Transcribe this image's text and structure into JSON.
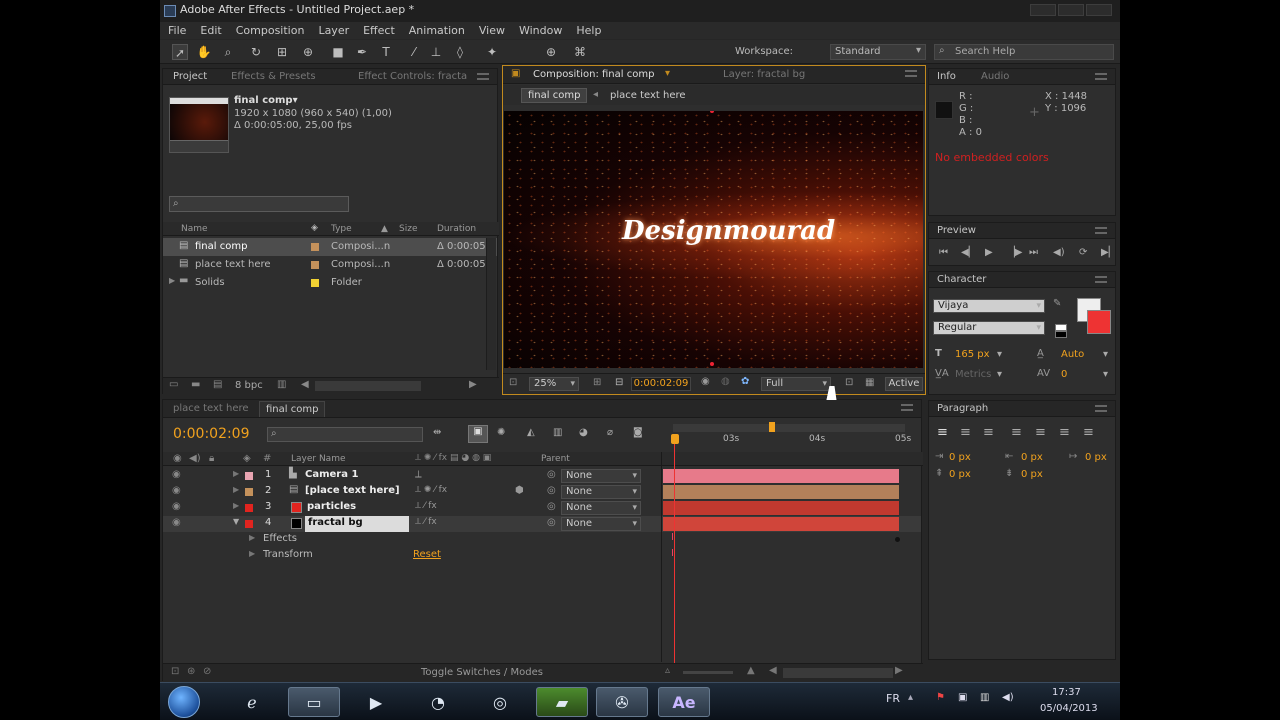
{
  "app": {
    "title": "Adobe After Effects - Untitled Project.aep *",
    "menu": [
      "File",
      "Edit",
      "Composition",
      "Layer",
      "Effect",
      "Animation",
      "View",
      "Window",
      "Help"
    ]
  },
  "toolbar": {
    "workspace_label": "Workspace:",
    "workspace_value": "Standard",
    "search_help_placeholder": "Search Help"
  },
  "project": {
    "tabs": [
      "Project",
      "Effects & Presets",
      "Effect Controls: fracta"
    ],
    "selected_name": "final comp▾",
    "selected_info_1": "1920 x 1080  (960 x 540) (1,00)",
    "selected_info_2": "Δ 0:00:05:00, 25,00 fps",
    "columns": [
      "Name",
      "Type",
      "Size",
      "Duration"
    ],
    "items": [
      {
        "name": "final comp",
        "type": "Composi...n",
        "duration": "Δ 0:00:05",
        "label_color": "#c4915b",
        "selected": true
      },
      {
        "name": "place text here",
        "type": "Composi...n",
        "duration": "Δ 0:00:05",
        "label_color": "#c4915b",
        "selected": false
      },
      {
        "name": "Solids",
        "type": "Folder",
        "duration": "",
        "label_color": "#f2d233",
        "selected": false
      }
    ],
    "bpc": "8 bpc"
  },
  "composition": {
    "tabs": [
      "Composition: final comp",
      "Layer: fractal bg"
    ],
    "breadcrumbs": [
      "final comp",
      "place text here"
    ],
    "preview_text": "Designmourad",
    "zoom": "25%",
    "timecode": "0:00:02:09",
    "resolution": "Full",
    "camera": "Active"
  },
  "info": {
    "tabs": [
      "Info",
      "Audio"
    ],
    "r": "R :",
    "g": "G :",
    "b": "B :",
    "a": "A : 0",
    "x": "X : 1448",
    "y": "Y : 1096",
    "message": "No embedded colors"
  },
  "preview": {
    "title": "Preview"
  },
  "character": {
    "title": "Character",
    "font": "Vijaya",
    "style": "Regular",
    "size": "165 px",
    "leading": "Auto",
    "kerning": "Metrics",
    "tracking": "0"
  },
  "paragraph": {
    "title": "Paragraph",
    "indent_left": "0 px",
    "indent_right": "0 px",
    "indent_first": "0 px",
    "space_before": "0 px",
    "space_after": "0 px"
  },
  "timeline": {
    "tabs": [
      "place text here",
      "final comp"
    ],
    "timecode": "0:00:02:09",
    "columns": {
      "layer_name": "Layer Name",
      "parent": "Parent"
    },
    "ruler": [
      "03s",
      "04s",
      "05s"
    ],
    "layers": [
      {
        "num": "1",
        "name": "Camera 1",
        "label_color": "#e9a5b2",
        "parent": "None",
        "bar": "#e77a8a",
        "icon": "camera"
      },
      {
        "num": "2",
        "name": "[place text here]",
        "label_color": "#c4915b",
        "parent": "None",
        "bar": "#b3805a",
        "icon": "comp"
      },
      {
        "num": "3",
        "name": "particles",
        "label_color": "#e1241f",
        "parent": "None",
        "bar": "#c1392f",
        "icon": "solid-red"
      },
      {
        "num": "4",
        "name": "fractal bg",
        "label_color": "#e1241f",
        "parent": "None",
        "bar": "#d0453a",
        "icon": "solid-black",
        "selected": true
      }
    ],
    "sub_rows": [
      "Effects",
      "Transform"
    ],
    "reset_label": "Reset",
    "footer": "Toggle Switches / Modes"
  },
  "taskbar": {
    "lang": "FR",
    "time": "17:37",
    "date": "05/04/2013",
    "ae_label": "Ae"
  }
}
